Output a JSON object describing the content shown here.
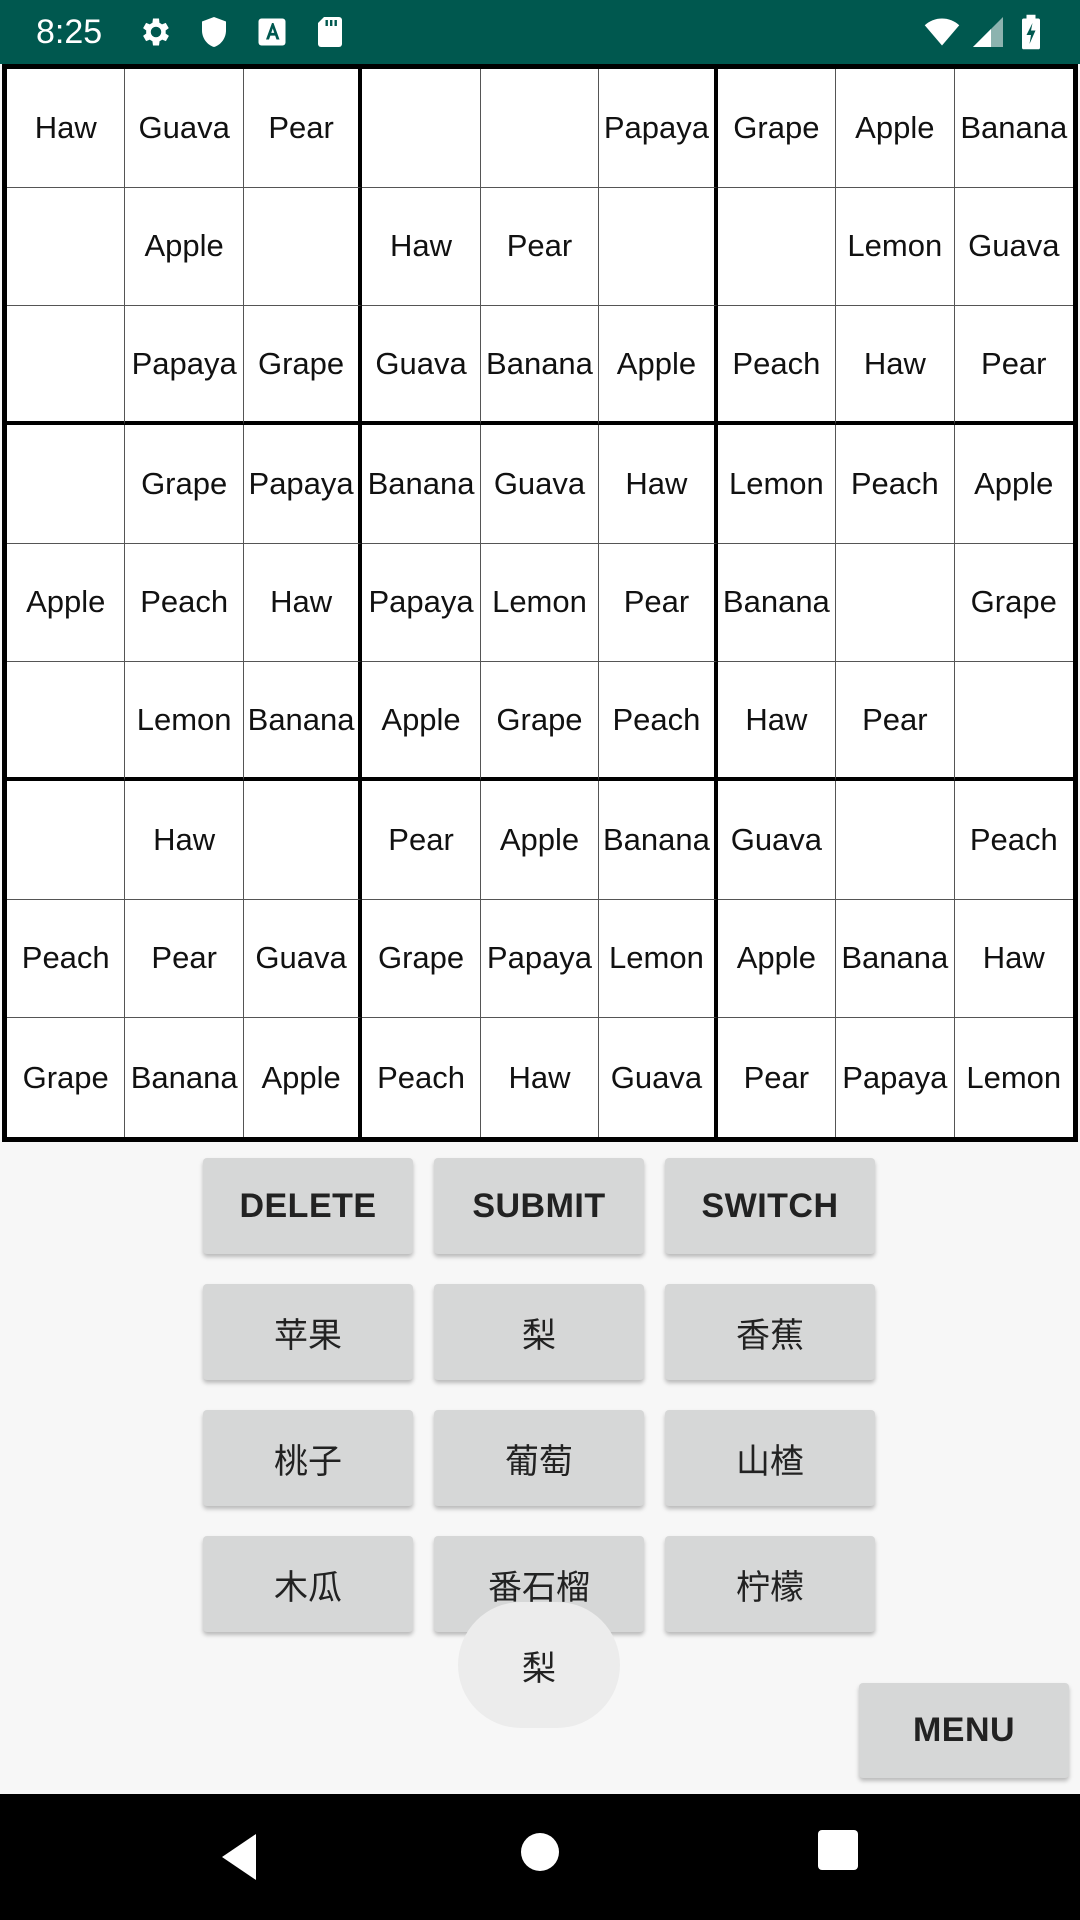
{
  "status_bar": {
    "time": "8:25",
    "icons_left": [
      "gear-icon",
      "shield-icon",
      "font-a-icon",
      "sd-card-icon"
    ],
    "icons_right": [
      "wifi-icon",
      "cell-signal-icon",
      "battery-icon"
    ]
  },
  "board": {
    "rows": [
      [
        "Haw",
        "Guava",
        "Pear",
        "",
        "",
        "Papaya",
        "Grape",
        "Apple",
        "Banana"
      ],
      [
        "",
        "Apple",
        "",
        "Haw",
        "Pear",
        "",
        "",
        "Lemon",
        "Guava"
      ],
      [
        "",
        "Papaya",
        "Grape",
        "Guava",
        "Banana",
        "Apple",
        "Peach",
        "Haw",
        "Pear"
      ],
      [
        "",
        "Grape",
        "Papaya",
        "Banana",
        "Guava",
        "Haw",
        "Lemon",
        "Peach",
        "Apple"
      ],
      [
        "Apple",
        "Peach",
        "Haw",
        "Papaya",
        "Lemon",
        "Pear",
        "Banana",
        "",
        "Grape"
      ],
      [
        "",
        "Lemon",
        "Banana",
        "Apple",
        "Grape",
        "Peach",
        "Haw",
        "Pear",
        ""
      ],
      [
        "",
        "Haw",
        "",
        "Pear",
        "Apple",
        "Banana",
        "Guava",
        "",
        "Peach"
      ],
      [
        "Peach",
        "Pear",
        "Guava",
        "Grape",
        "Papaya",
        "Lemon",
        "Apple",
        "Banana",
        "Haw"
      ],
      [
        "Grape",
        "Banana",
        "Apple",
        "Peach",
        "Haw",
        "Guava",
        "Pear",
        "Papaya",
        "Lemon"
      ]
    ]
  },
  "actions": {
    "delete": "DELETE",
    "submit": "SUBMIT",
    "switch": "SWITCH",
    "menu": "MENU"
  },
  "fruit_keys": [
    "苹果",
    "梨",
    "香蕉",
    "桃子",
    "葡萄",
    "山楂",
    "木瓜",
    "番石榴",
    "柠檬"
  ],
  "floating_hint": "梨",
  "nav_bar": {
    "icons": [
      "back-icon",
      "home-icon",
      "recents-icon"
    ]
  }
}
